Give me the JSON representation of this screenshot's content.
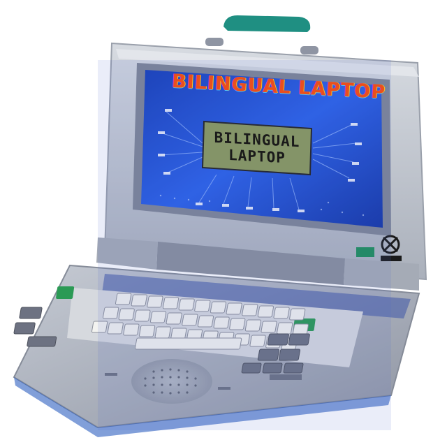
{
  "product": {
    "screen_title": "BILINGUAL LAPTOP",
    "lcd_line_1": "BILINGUAL",
    "lcd_line_2": "LAPTOP"
  },
  "colors": {
    "body_silver": "#bcc2cc",
    "body_dark": "#8f95a3",
    "screen_blue": "#1f4fd8",
    "lcd_green": "#8b9a5b",
    "handle_teal": "#1f8f82",
    "key_white": "#f3f3f0",
    "key_dark": "#6d7282",
    "key_green": "#2b9a55"
  }
}
